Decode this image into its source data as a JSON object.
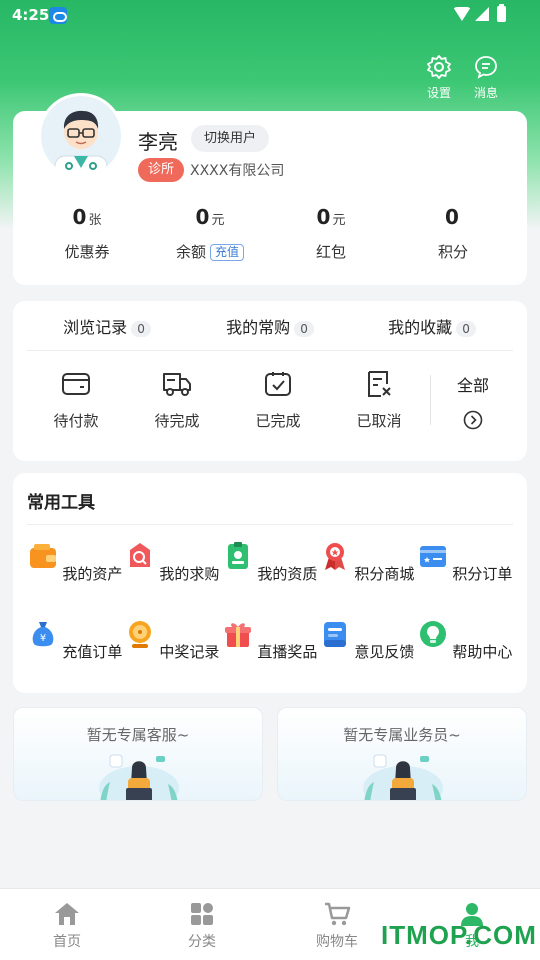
{
  "status_bar": {
    "time": "4:25"
  },
  "header": {
    "settings_label": "设置",
    "messages_label": "消息"
  },
  "profile": {
    "name": "李亮",
    "switch_user": "切换用户",
    "badge": "诊所",
    "company": "XXXX有限公司"
  },
  "stats": [
    {
      "value": "0",
      "unit": "张",
      "label": "优惠券"
    },
    {
      "value": "0",
      "unit": "元",
      "label": "余额",
      "tag": "充值"
    },
    {
      "value": "0",
      "unit": "元",
      "label": "红包"
    },
    {
      "value": "0",
      "unit": "",
      "label": "积分"
    }
  ],
  "history": [
    {
      "label": "浏览记录",
      "count": "0"
    },
    {
      "label": "我的常购",
      "count": "0"
    },
    {
      "label": "我的收藏",
      "count": "0"
    }
  ],
  "orders": [
    {
      "label": "待付款",
      "icon": "wallet-icon"
    },
    {
      "label": "待完成",
      "icon": "truck-icon"
    },
    {
      "label": "已完成",
      "icon": "box-check-icon"
    },
    {
      "label": "已取消",
      "icon": "doc-cancel-icon"
    }
  ],
  "all_orders": "全部",
  "tools": {
    "title": "常用工具",
    "items": [
      {
        "label": "我的资产",
        "icon": "wallet-icon",
        "color": "#f7931e"
      },
      {
        "label": "我的求购",
        "icon": "search-bag-icon",
        "color": "#f0585b"
      },
      {
        "label": "我的资质",
        "icon": "certificate-icon",
        "color": "#2fbf71"
      },
      {
        "label": "积分商城",
        "icon": "medal-icon",
        "color": "#f04e4e"
      },
      {
        "label": "积分订单",
        "icon": "card-icon",
        "color": "#3c8df0"
      },
      {
        "label": "充值订单",
        "icon": "money-bag-icon",
        "color": "#3c8df0"
      },
      {
        "label": "中奖记录",
        "icon": "prize-wheel-icon",
        "color": "#f7a41e"
      },
      {
        "label": "直播奖品",
        "icon": "gift-icon",
        "color": "#f04e4e"
      },
      {
        "label": "意见反馈",
        "icon": "feedback-icon",
        "color": "#3c8df0"
      },
      {
        "label": "帮助中心",
        "icon": "lightbulb-icon",
        "color": "#2fbf71"
      }
    ]
  },
  "service": {
    "customer_service": "暂无专属客服~",
    "salesperson": "暂无专属业务员~"
  },
  "tabbar": [
    {
      "label": "首页",
      "icon": "home-icon"
    },
    {
      "label": "分类",
      "icon": "grid-icon"
    },
    {
      "label": "购物车",
      "icon": "cart-icon"
    },
    {
      "label": "我",
      "icon": "user-icon",
      "active": true
    }
  ],
  "watermark": "ITMOP.COM",
  "colors": {
    "primary": "#2cb866",
    "badge": "#f06a5b",
    "link": "#3a7bd5"
  }
}
